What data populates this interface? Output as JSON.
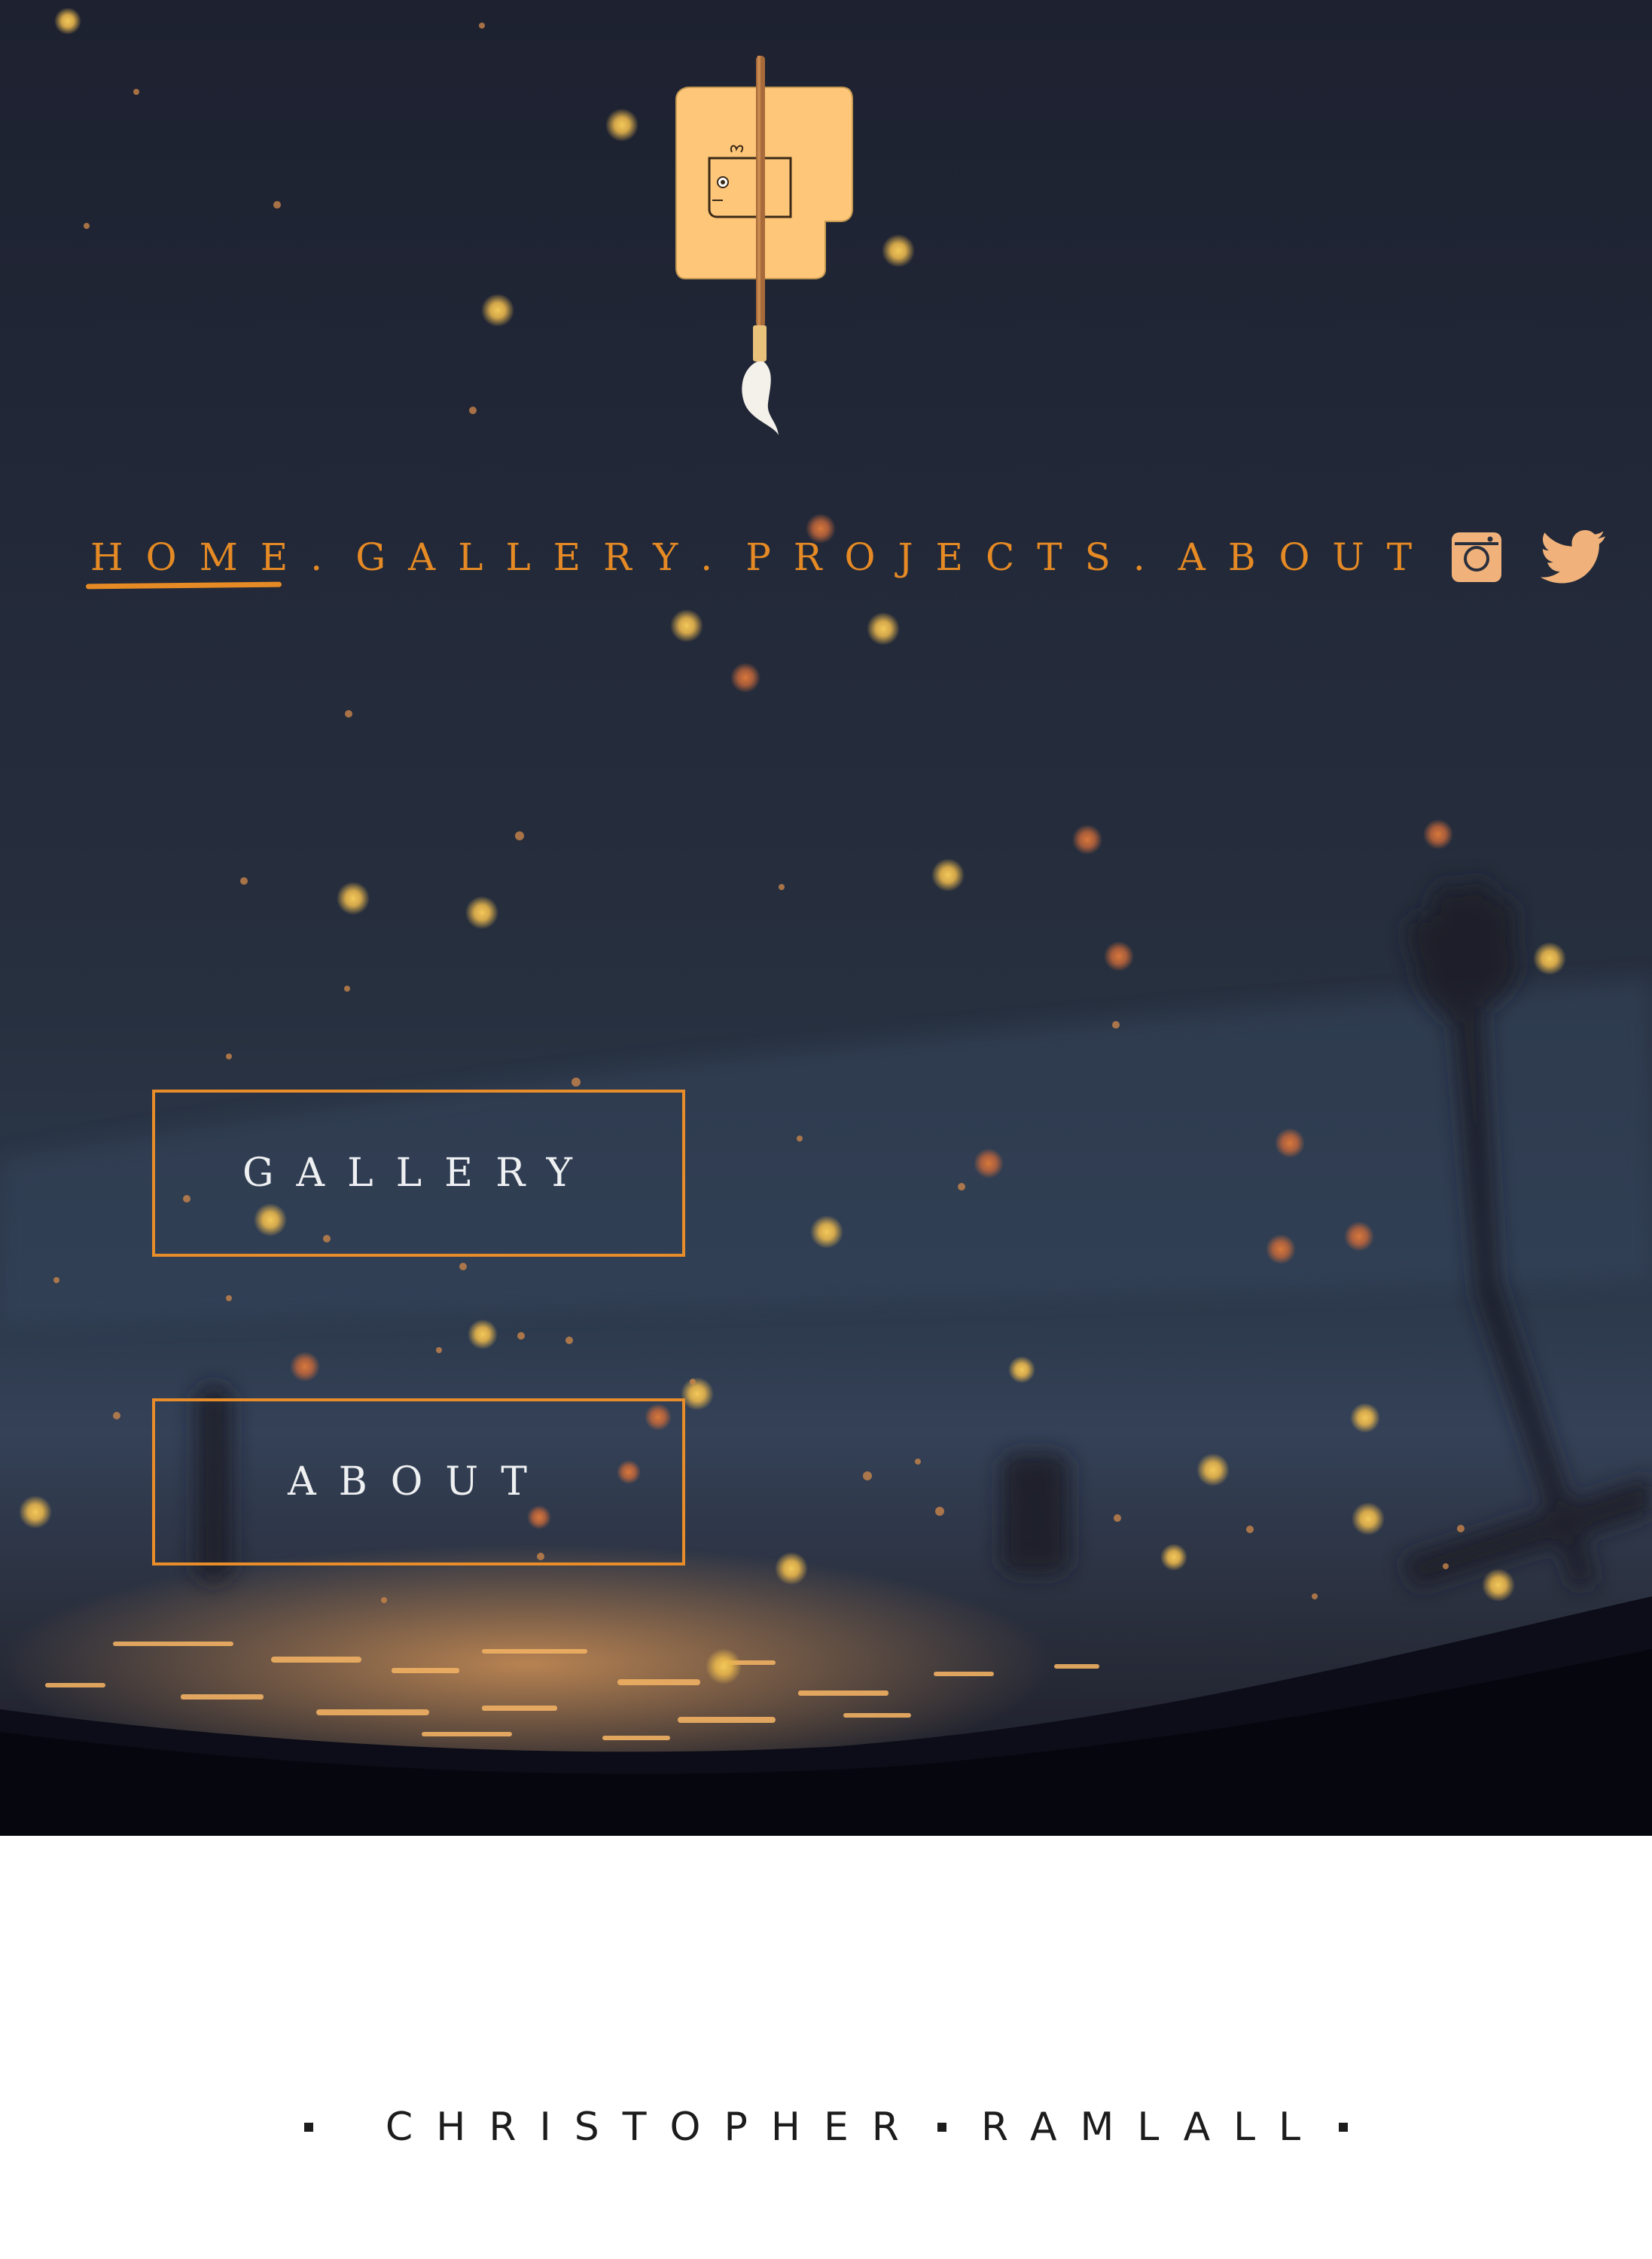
{
  "nav": {
    "items": [
      {
        "label": "HOME",
        "active": true
      },
      {
        "label": "GALLERY",
        "active": false
      },
      {
        "label": "PROJECTS",
        "active": false
      },
      {
        "label": "ABOUT",
        "active": false
      }
    ],
    "separator": "."
  },
  "social": [
    "instagram-icon",
    "twitter-icon"
  ],
  "buttons": {
    "gallery": "GALLERY",
    "about": "ABOUT"
  },
  "footer": {
    "first_name": "CHRISTOPHER",
    "last_name": "RAMLALL"
  },
  "colors": {
    "accent": "#e58a24",
    "logo": "#fdc679",
    "sky": "#1d2130",
    "footer_text": "#1c1c1c"
  }
}
